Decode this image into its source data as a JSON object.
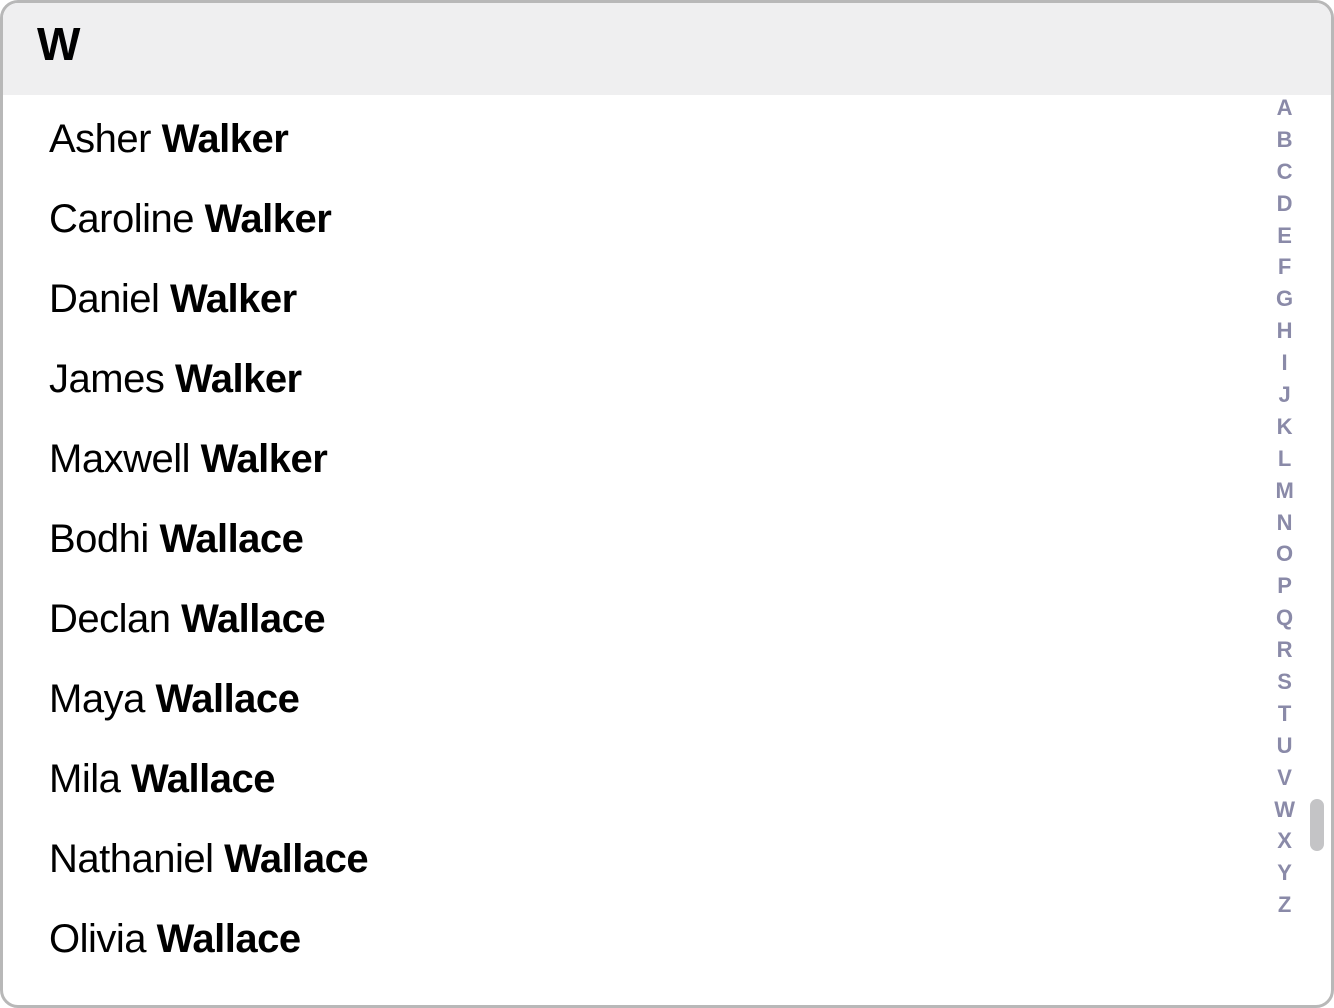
{
  "section": {
    "letter": "W"
  },
  "contacts": [
    {
      "first": "Asher",
      "last": "Walker"
    },
    {
      "first": "Caroline",
      "last": "Walker"
    },
    {
      "first": "Daniel",
      "last": "Walker"
    },
    {
      "first": "James",
      "last": "Walker"
    },
    {
      "first": "Maxwell",
      "last": "Walker"
    },
    {
      "first": "Bodhi",
      "last": "Wallace"
    },
    {
      "first": "Declan",
      "last": "Wallace"
    },
    {
      "first": "Maya",
      "last": "Wallace"
    },
    {
      "first": "Mila",
      "last": "Wallace"
    },
    {
      "first": "Nathaniel",
      "last": "Wallace"
    },
    {
      "first": "Olivia",
      "last": "Wallace"
    }
  ],
  "index": [
    "A",
    "B",
    "C",
    "D",
    "E",
    "F",
    "G",
    "H",
    "I",
    "J",
    "K",
    "L",
    "M",
    "N",
    "O",
    "P",
    "Q",
    "R",
    "S",
    "T",
    "U",
    "V",
    "W",
    "X",
    "Y",
    "Z"
  ]
}
